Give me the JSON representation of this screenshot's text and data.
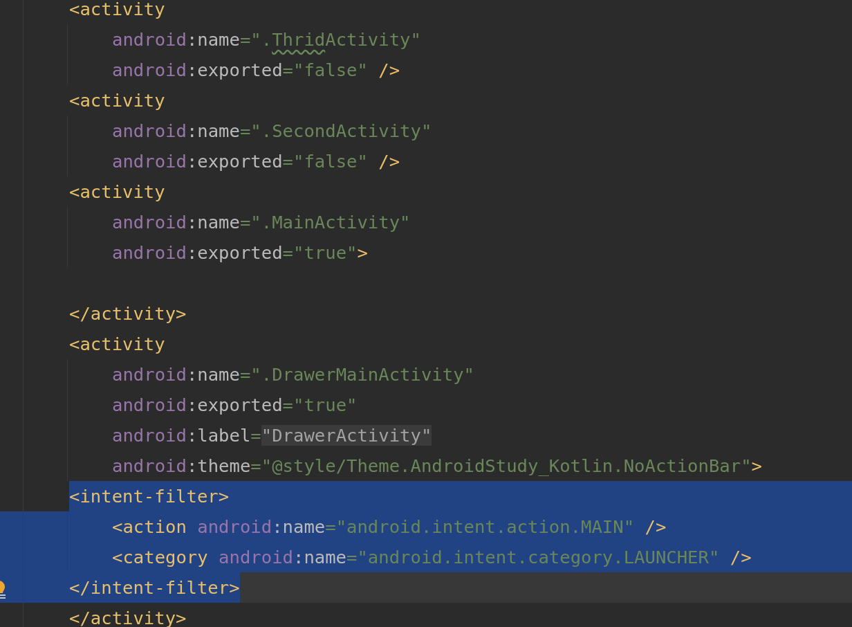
{
  "editor": {
    "lines": [
      {
        "selected": false,
        "tokens": [
          {
            "kind": "tag",
            "text": "<activity"
          }
        ],
        "children": [
          {
            "selected": false,
            "tokens": [
              {
                "kind": "ns",
                "text": "android"
              },
              {
                "kind": "punct",
                "text": ":"
              },
              {
                "kind": "attr",
                "text": "name"
              },
              {
                "kind": "eq",
                "text": "="
              },
              {
                "kind": "string",
                "text": "\"."
              },
              {
                "kind": "string",
                "text": "Thrid",
                "typo": true
              },
              {
                "kind": "string",
                "text": "Activity\""
              }
            ]
          },
          {
            "selected": false,
            "tokens": [
              {
                "kind": "ns",
                "text": "android"
              },
              {
                "kind": "punct",
                "text": ":"
              },
              {
                "kind": "attr",
                "text": "exported"
              },
              {
                "kind": "eq",
                "text": "="
              },
              {
                "kind": "string",
                "text": "\"false\""
              },
              {
                "kind": "tag",
                "text": " />"
              }
            ]
          }
        ]
      },
      {
        "selected": false,
        "tokens": [
          {
            "kind": "tag",
            "text": "<activity"
          }
        ],
        "children": [
          {
            "selected": false,
            "tokens": [
              {
                "kind": "ns",
                "text": "android"
              },
              {
                "kind": "punct",
                "text": ":"
              },
              {
                "kind": "attr",
                "text": "name"
              },
              {
                "kind": "eq",
                "text": "="
              },
              {
                "kind": "string",
                "text": "\".SecondActivity\""
              }
            ]
          },
          {
            "selected": false,
            "tokens": [
              {
                "kind": "ns",
                "text": "android"
              },
              {
                "kind": "punct",
                "text": ":"
              },
              {
                "kind": "attr",
                "text": "exported"
              },
              {
                "kind": "eq",
                "text": "="
              },
              {
                "kind": "string",
                "text": "\"false\""
              },
              {
                "kind": "tag",
                "text": " />"
              }
            ]
          }
        ]
      },
      {
        "selected": false,
        "tokens": [
          {
            "kind": "tag",
            "text": "<activity"
          }
        ],
        "children": [
          {
            "selected": false,
            "tokens": [
              {
                "kind": "ns",
                "text": "android"
              },
              {
                "kind": "punct",
                "text": ":"
              },
              {
                "kind": "attr",
                "text": "name"
              },
              {
                "kind": "eq",
                "text": "="
              },
              {
                "kind": "string",
                "text": "\".MainActivity\""
              }
            ]
          },
          {
            "selected": false,
            "tokens": [
              {
                "kind": "ns",
                "text": "android"
              },
              {
                "kind": "punct",
                "text": ":"
              },
              {
                "kind": "attr",
                "text": "exported"
              },
              {
                "kind": "eq",
                "text": "="
              },
              {
                "kind": "string",
                "text": "\"true\""
              },
              {
                "kind": "tag",
                "text": ">"
              }
            ]
          }
        ]
      },
      {
        "selected": false
      },
      {
        "selected": false,
        "tokens": [
          {
            "kind": "tag",
            "text": "</activity>"
          }
        ]
      },
      {
        "selected": false,
        "tokens": [
          {
            "kind": "tag",
            "text": "<activity"
          }
        ],
        "children": [
          {
            "selected": false,
            "tokens": [
              {
                "kind": "ns",
                "text": "android"
              },
              {
                "kind": "punct",
                "text": ":"
              },
              {
                "kind": "attr",
                "text": "name"
              },
              {
                "kind": "eq",
                "text": "="
              },
              {
                "kind": "string",
                "text": "\".DrawerMainActivity\""
              }
            ]
          },
          {
            "selected": false,
            "tokens": [
              {
                "kind": "ns",
                "text": "android"
              },
              {
                "kind": "punct",
                "text": ":"
              },
              {
                "kind": "attr",
                "text": "exported"
              },
              {
                "kind": "eq",
                "text": "="
              },
              {
                "kind": "string",
                "text": "\"true\""
              }
            ]
          },
          {
            "selected": false,
            "tokens": [
              {
                "kind": "ns",
                "text": "android"
              },
              {
                "kind": "punct",
                "text": ":"
              },
              {
                "kind": "attr",
                "text": "label"
              },
              {
                "kind": "eq",
                "text": "="
              },
              {
                "kind": "string",
                "text": "\"DrawerActivity\"",
                "highlighted": true
              }
            ]
          },
          {
            "selected": false,
            "tokens": [
              {
                "kind": "ns",
                "text": "android"
              },
              {
                "kind": "punct",
                "text": ":"
              },
              {
                "kind": "attr",
                "text": "theme"
              },
              {
                "kind": "eq",
                "text": "="
              },
              {
                "kind": "string",
                "text": "\"@style/Theme.AndroidStudy_Kotlin.NoActionBar\""
              },
              {
                "kind": "tag",
                "text": ">"
              }
            ]
          }
        ]
      },
      {
        "selected": true,
        "tokens": [
          {
            "kind": "tag",
            "text": "<intent-filter>"
          }
        ],
        "children": [
          {
            "selected": true,
            "tokens": [
              {
                "kind": "tag",
                "text": "<action "
              },
              {
                "kind": "ns",
                "text": "android"
              },
              {
                "kind": "punct",
                "text": ":"
              },
              {
                "kind": "attr",
                "text": "name"
              },
              {
                "kind": "eq",
                "text": "="
              },
              {
                "kind": "string",
                "text": "\"android.intent.action.MAIN\""
              },
              {
                "kind": "tag",
                "text": " />"
              }
            ]
          },
          {
            "selected": true,
            "tokens": [
              {
                "kind": "tag",
                "text": "<category "
              },
              {
                "kind": "ns",
                "text": "android"
              },
              {
                "kind": "punct",
                "text": ":"
              },
              {
                "kind": "attr",
                "text": "name"
              },
              {
                "kind": "eq",
                "text": "="
              },
              {
                "kind": "string",
                "text": "\"android.intent.category.LAUNCHER\""
              },
              {
                "kind": "tag",
                "text": " />"
              }
            ]
          }
        ]
      },
      {
        "selected": true,
        "caret": true,
        "intention_bulb": true,
        "tokens": [
          {
            "kind": "tag",
            "text": "</intent-filter>"
          }
        ]
      },
      {
        "selected": false,
        "tokens": [
          {
            "kind": "tag",
            "text": "</activity>"
          }
        ]
      }
    ]
  }
}
